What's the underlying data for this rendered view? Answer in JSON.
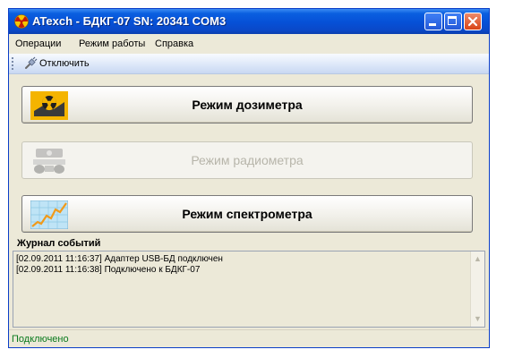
{
  "window": {
    "title": "ATexch - БДКГ-07 SN: 20341 COM3"
  },
  "menu": {
    "items": [
      "Операции",
      "Режим работы",
      "Справка"
    ]
  },
  "toolbar": {
    "disconnect_label": "Отключить",
    "disconnect_icon": "plug-icon"
  },
  "modes": [
    {
      "label": "Режим дозиметра",
      "icon": "dosimeter-radiation-icon",
      "enabled": true
    },
    {
      "label": "Режим радиометра",
      "icon": "radiometer-icon",
      "enabled": false
    },
    {
      "label": "Режим спектрометра",
      "icon": "spectrum-chart-icon",
      "enabled": true
    }
  ],
  "log": {
    "title": "Журнал событий",
    "lines": [
      "[02.09.2011 11:16:37] Адаптер USB-БД подключен",
      "[02.09.2011 11:16:38] Подключено к БДКГ-07"
    ]
  },
  "status": {
    "text": "Подключено",
    "color": "#0a7a1e"
  },
  "colors": {
    "titlebar": "#0650d6",
    "close_button": "#d94416",
    "window_bg": "#ece9d8"
  }
}
